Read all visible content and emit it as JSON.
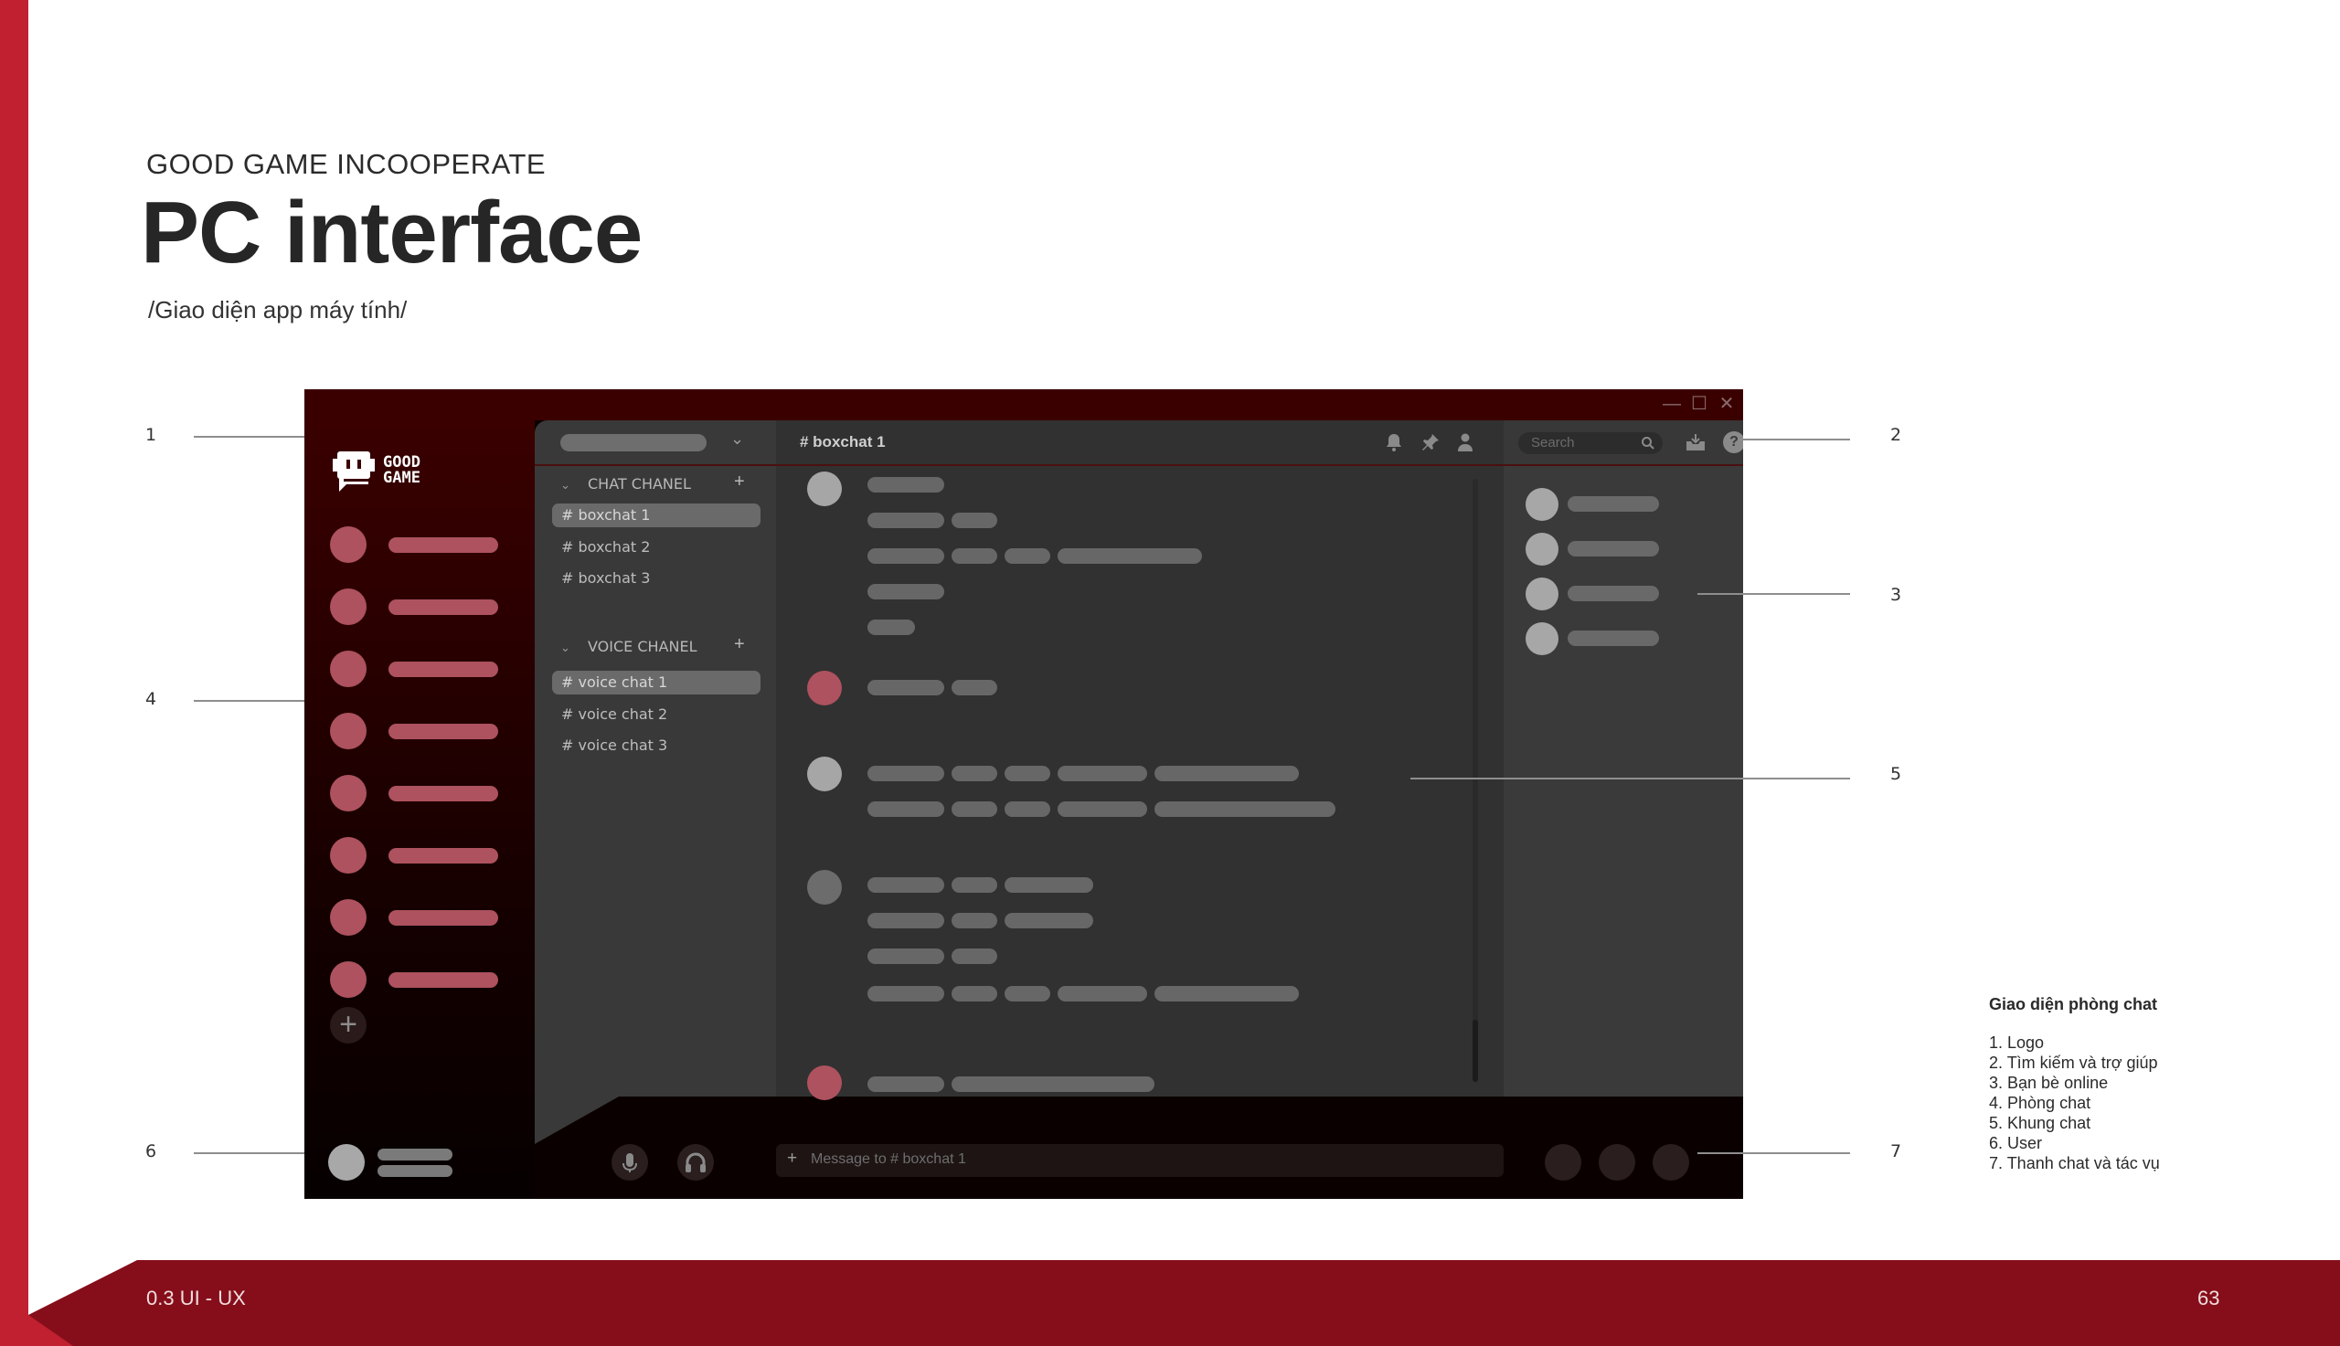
{
  "slide": {
    "kicker": "GOOD GAME INCOOPERATE",
    "title": "PC interface",
    "subtitle": "/Giao diện app máy tính/",
    "footer_section": "0.3 UI - UX",
    "page_number": "63",
    "colors": {
      "brand_red": "#c0202f",
      "footer_red": "#850e1a",
      "accent_pink": "#ad525e"
    }
  },
  "annotations": {
    "left": [
      "1",
      "4",
      "6"
    ],
    "right": [
      "2",
      "3",
      "5",
      "7"
    ]
  },
  "legend": {
    "title": "Giao diện phòng chat",
    "items": [
      "1. Logo",
      "2. Tìm kiếm và trợ giúp",
      "3. Bạn bè online",
      "4. Phòng chat",
      "5. Khung chat",
      "6. User",
      "7. Thanh chat và tác vụ"
    ]
  },
  "app": {
    "window_controls": {
      "minimize": "—",
      "maximize": "☐",
      "close": "✕"
    },
    "logo": {
      "line1": "GOOD",
      "line2": "GAME"
    },
    "channels": {
      "chat_category": "CHAT CHANEL",
      "voice_category": "VOICE CHANEL",
      "add_icon": "+",
      "chevron": "⌄",
      "chat": [
        "# boxchat 1",
        "# boxchat 2",
        "# boxchat 3"
      ],
      "voice": [
        "# voice chat 1",
        "# voice chat 2",
        "# voice chat 3"
      ]
    },
    "main": {
      "channel_title": "# boxchat 1",
      "message_placeholder": "Message to # boxchat 1",
      "input_add_icon": "+"
    },
    "search": {
      "placeholder": "Search"
    },
    "server_add_icon": "+"
  }
}
